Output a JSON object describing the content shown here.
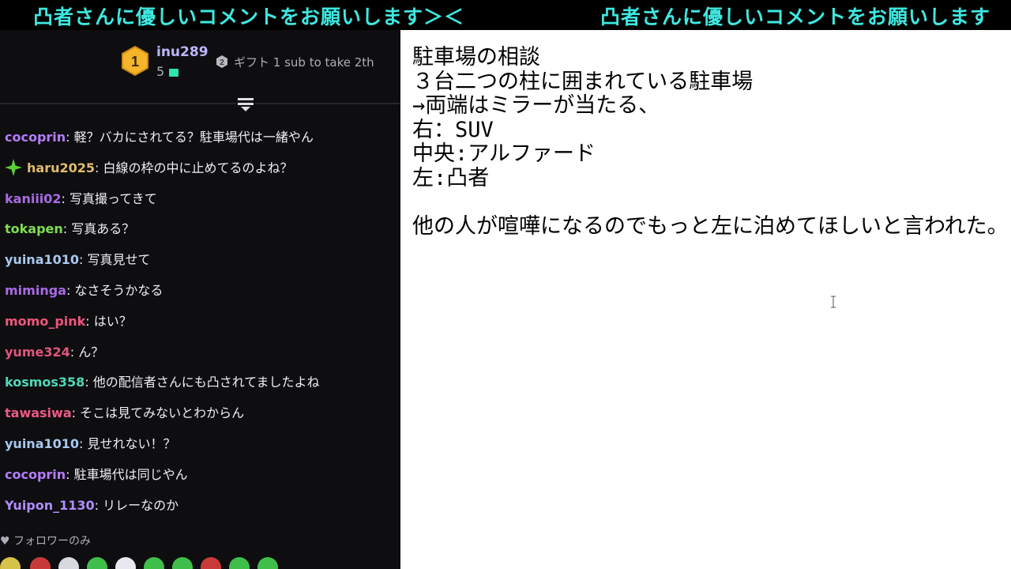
{
  "ticker": {
    "text1": "凸者さんに優しいコメントをお願いします＞＜",
    "text2": "凸者さんに優しいコメントをお願いします"
  },
  "leaderboard": {
    "first_rank": "1",
    "first_name": "inu289",
    "first_count": "5",
    "second_rank": "2",
    "second_text": "ギフト 1 sub to take 2th"
  },
  "chat": {
    "messages": [
      {
        "user": "cocoprin",
        "color": "#b57cff",
        "text": ": 軽？バカにされてる？駐車場代は一緒やん"
      },
      {
        "user": "haru2025",
        "color": "#e2bc6b",
        "text": ": 白線の枠の中に止めてるのよね？"
      },
      {
        "user": "kaniii02",
        "color": "#a96ae6",
        "text": ": 写真撮ってきて"
      },
      {
        "user": "tokapen",
        "color": "#7dde52",
        "text": ": 写真ある？"
      },
      {
        "user": "yuina1010",
        "color": "#a8c8f0",
        "text": ": 写真見せて"
      },
      {
        "user": "miminga",
        "color": "#a96ae6",
        "text": ": なさそうかなる"
      },
      {
        "user": "momo_pink",
        "color": "#f0557c",
        "text": ": はい？"
      },
      {
        "user": "yume324",
        "color": "#e0557c",
        "text": ": ん？"
      },
      {
        "user": "kosmos358",
        "color": "#4fd8b8",
        "text": ": 他の配信者さんにも凸されてましたよね"
      },
      {
        "user": "tawasiwa",
        "color": "#ee5a85",
        "text": ": そこは見てみないとわからん"
      },
      {
        "user": "yuina1010",
        "color": "#a8c8f0",
        "text": ": 見せれない！？"
      },
      {
        "user": "cocoprin",
        "color": "#b57cff",
        "text": ": 駐車場代は同じやん"
      },
      {
        "user": "Yuipon_1130",
        "color": "#b08cff",
        "text": ": リレーなのか"
      }
    ],
    "followers_only": "フォロワーのみ"
  },
  "note": {
    "lines": [
      "駐車場の相談",
      "３台二つの柱に囲まれている駐車場",
      "→両端はミラーが当たる、",
      "右：SUV",
      "中央:アルファード",
      "左:凸者",
      "",
      "他の人が喧嘩になるのでもっと左に泊めてほしいと言われた。"
    ]
  },
  "colors": {
    "ticker_text": "#3ee8e0",
    "chat_bg": "#0e0e10",
    "badge_gold": "#f5b52a",
    "gift_green": "#2ee6a8"
  },
  "icons": {
    "rank1": "gold-hexagon-badge-icon",
    "rank2": "silver-hexagon-badge-icon",
    "gift": "gift-icon",
    "collapse": "collapse-arrow-icon",
    "sparkle": "sparkle-badge-icon",
    "heart": "heart-icon",
    "caret": "text-cursor-icon"
  }
}
